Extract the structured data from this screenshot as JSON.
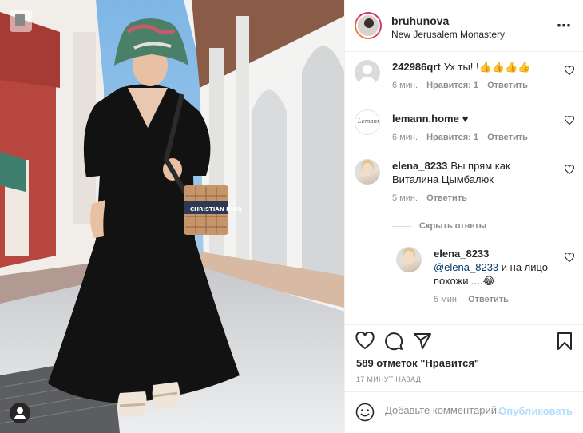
{
  "header": {
    "username": "bruhunova",
    "location": "New Jerusalem Monastery",
    "more_icon": "⋯"
  },
  "comments": [
    {
      "user": "242986qrt",
      "text": "Ух ты! !👍👍👍👍",
      "time": "6 мин.",
      "likes": "Нравится: 1",
      "reply": "Ответить",
      "avatar": "default-avatar"
    },
    {
      "user": "lemann.home",
      "text": "♥",
      "time": "6 мин.",
      "likes": "Нравится: 1",
      "reply": "Ответить",
      "avatar": "lemann-logo"
    },
    {
      "user": "elena_8233",
      "text": "Вы прям как Виталина Цымбалюк",
      "time": "5 мин.",
      "reply": "Ответить",
      "avatar": "elena-photo"
    }
  ],
  "hide_replies": "Скрыть ответы",
  "reply": {
    "user": "elena_8233",
    "mention": "@elena_8233",
    "text": " и на лицо похожи ....😂",
    "time": "5 мин.",
    "reply": "Ответить"
  },
  "likes_count": "589 отметок \"Нравится\"",
  "time_ago": "17 МИНУТ НАЗАД",
  "add_comment": {
    "placeholder": "Добавьте комментарий...",
    "post_label": "Опубликовать"
  },
  "photo": {
    "bag_text": "CHRISTIAN DIOR"
  },
  "colors": {
    "link": "#00376b",
    "post_disabled": "#b2dffc",
    "meta": "#8e8e8e"
  }
}
